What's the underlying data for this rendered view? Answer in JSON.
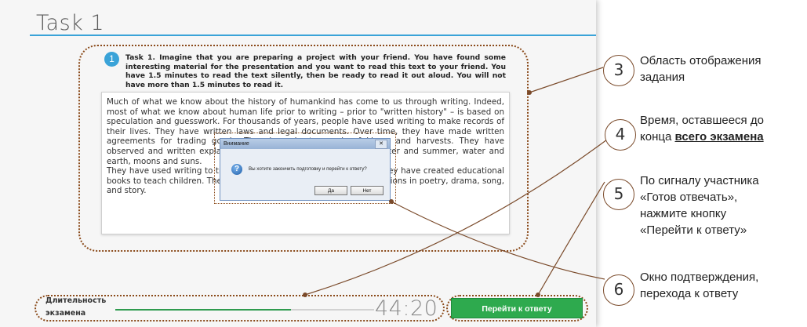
{
  "window": {
    "title": "Task 1",
    "top_strip_text": ""
  },
  "task": {
    "number": "1",
    "instruction": "Task 1. Imagine that you are preparing a project with your friend. You have found some interesting material for the presentation and you want to read this text to your friend. You have 1.5 minutes to read the text silently, then be ready to read it out aloud. You will not have more than 1.5 minutes to read it.",
    "paragraphs": [
      "Much of what we know about the history of humankind has come to us through writing. Indeed, most of what we know about human life prior to writing – prior to \"written history\" – is based on speculation and guesswork. For thousands of years, people have used writing to make records of their lives. They have written laws and legal documents. Over time, they have made written agreements for trading goods. They have kept records of kings, and harvests. They have observed and written explanations of the stars, day and night, winter and summer, water and earth, moons and suns.",
      "They have used writing to transmit their knowledge and religions. They have created educational books to teach children. They have expressed their feelings and emotions in poetry, drama, song, and story."
    ]
  },
  "dialog": {
    "title": "Внимание",
    "close": "✕",
    "icon": "question-icon",
    "message": "Вы хотите закончить подготовку и перейти к ответу?",
    "yes_label": "Да",
    "no_label": "Нет"
  },
  "footer": {
    "duration_label_1": "Длительность",
    "duration_label_2": "экзамена",
    "progress": 0.68,
    "timer": "44:20",
    "answer_button": "Перейти к ответу"
  },
  "callouts": [
    {
      "num": "3",
      "text_1": "Область отображения",
      "text_2": "задания"
    },
    {
      "num": "4",
      "text_1": "Время, оставшееся до",
      "text_2_prefix": "конца ",
      "text_2_bold": "всего экзамена"
    },
    {
      "num": "5",
      "text_1": "По сигналу участника",
      "text_2": "«Готов отвечать»,",
      "text_3": "нажмите кнопку",
      "text_4": "«Перейти к ответу»"
    },
    {
      "num": "6",
      "text_1": "Окно подтверждения,",
      "text_2": "перехода к ответу"
    }
  ],
  "colors": {
    "accent_blue": "#3aa3d8",
    "button_green": "#2eaa4e",
    "annotation_brown": "#8a4a1a"
  }
}
